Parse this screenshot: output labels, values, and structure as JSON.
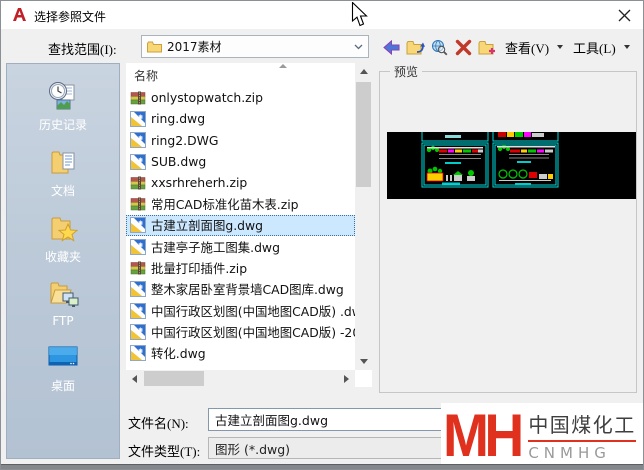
{
  "window": {
    "title": "选择参照文件"
  },
  "toolbar": {
    "look_in_label": "查找范围(I):",
    "look_in_value": "2017素材",
    "view_label": "查看(V)",
    "tools_label": "工具(L)"
  },
  "sidebar": {
    "items": [
      {
        "label": "历史记录",
        "icon": "history-icon"
      },
      {
        "label": "文档",
        "icon": "documents-icon"
      },
      {
        "label": "收藏夹",
        "icon": "favorites-icon"
      },
      {
        "label": "FTP",
        "icon": "ftp-icon"
      },
      {
        "label": "桌面",
        "icon": "desktop-icon"
      }
    ]
  },
  "file_list": {
    "header": "名称",
    "items": [
      {
        "name": "onlystopwatch.zip",
        "type": "zip",
        "selected": false
      },
      {
        "name": "ring.dwg",
        "type": "dwg",
        "selected": false
      },
      {
        "name": "ring2.DWG",
        "type": "dwg",
        "selected": false
      },
      {
        "name": "SUB.dwg",
        "type": "dwg",
        "selected": false
      },
      {
        "name": "xxsrhreherh.zip",
        "type": "zip",
        "selected": false
      },
      {
        "name": "常用CAD标准化苗木表.zip",
        "type": "zip",
        "selected": false
      },
      {
        "name": "古建立剖面图g.dwg",
        "type": "dwg",
        "selected": true
      },
      {
        "name": "古建亭子施工图集.dwg",
        "type": "dwg",
        "selected": false
      },
      {
        "name": "批量打印插件.zip",
        "type": "zip",
        "selected": false
      },
      {
        "name": "整木家居卧室背景墙CAD图库.dwg",
        "type": "dwg",
        "selected": false
      },
      {
        "name": "中国行政区划图(中国地图CAD版) .dw",
        "type": "dwg",
        "selected": false
      },
      {
        "name": "中国行政区划图(中国地图CAD版) -20",
        "type": "dwg",
        "selected": false
      },
      {
        "name": "转化.dwg",
        "type": "dwg",
        "selected": false
      }
    ]
  },
  "preview": {
    "label": "预览"
  },
  "form": {
    "file_name_label": "文件名(N):",
    "file_name_value": "古建立剖面图g.dwg",
    "file_type_label": "文件类型(T):",
    "file_type_value": "图形 (*.dwg)"
  },
  "watermark": {
    "logo_text": "MH",
    "company_cn": "中国煤化工",
    "company_en": "CNMHG",
    "accent_color": "#e0301e"
  },
  "icons": {
    "toolbar": [
      "back-icon",
      "up-one-level-icon",
      "search-web-icon",
      "delete-icon",
      "new-folder-icon"
    ]
  }
}
